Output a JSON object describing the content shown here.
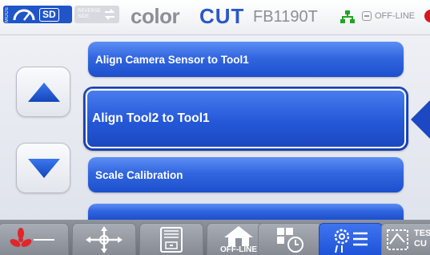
{
  "header": {
    "mode_label": "MODE",
    "sd_label": "SD",
    "reverse_line1": "REVERSE",
    "reverse_line2": "SIDE",
    "brand_color": "color",
    "brand_cut": "CUT",
    "model": "FB1190T",
    "status_label": "OFF-LINE",
    "status_color": "#d41a1a"
  },
  "list": {
    "items": [
      {
        "label": "Align Camera Sensor to Tool1",
        "selected": false
      },
      {
        "label": "Align Tool2 to Tool1",
        "selected": true
      },
      {
        "label": "Scale Calibration",
        "selected": false
      },
      {
        "label": "",
        "selected": false
      }
    ]
  },
  "scroll": {
    "up_icon": "triangle-up-icon",
    "down_icon": "triangle-down-icon"
  },
  "toolbar": {
    "fan_icon": "fan-icon",
    "move_icon": "move-arrows-icon",
    "storage_icon": "file-cabinet-icon",
    "home_label": "OFF-LINE",
    "layout_icon": "layout-timer-icon",
    "settings_icon": "settings-gears-icon",
    "test_cut_line1": "TES",
    "test_cut_line2": "CU"
  },
  "colors": {
    "accent": "#2b57c8",
    "item_blue": "#2458d8",
    "active_tab": "#2f63e4"
  }
}
